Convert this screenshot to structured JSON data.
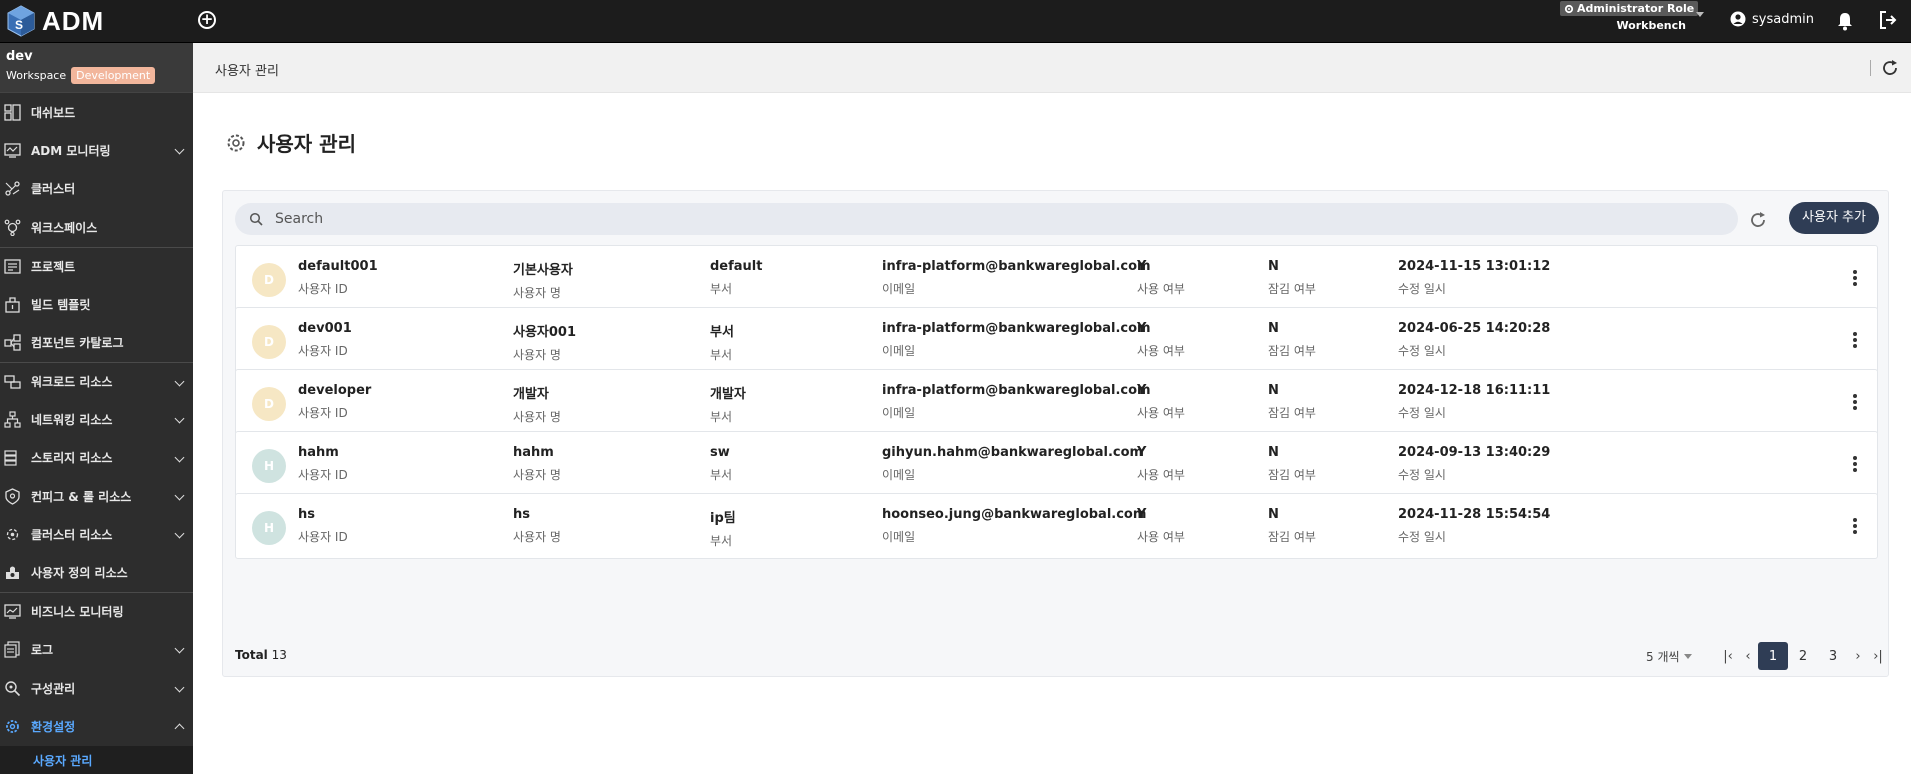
{
  "app": {
    "title": "ADM"
  },
  "topbar": {
    "role": "Administrator Role",
    "role_sub": "Workbench",
    "username": "sysadmin"
  },
  "workspace": {
    "name": "dev",
    "label": "Workspace",
    "badge": "Development"
  },
  "sidebar": {
    "items": [
      {
        "label": "대쉬보드",
        "icon": "dashboard-icon"
      },
      {
        "label": "ADM 모니터링",
        "icon": "monitor-icon"
      },
      {
        "label": "클러스터",
        "icon": "cluster-icon"
      },
      {
        "label": "워크스페이스",
        "icon": "workspace-icon"
      },
      {
        "label": "프로젝트",
        "icon": "project-icon"
      },
      {
        "label": "빌드 템플릿",
        "icon": "build-template-icon"
      },
      {
        "label": "컴포넌트 카탈로그",
        "icon": "component-catalog-icon"
      },
      {
        "label": "워크로드 리소스",
        "icon": "workload-icon"
      },
      {
        "label": "네트워킹 리소스",
        "icon": "network-icon"
      },
      {
        "label": "스토리지 리소스",
        "icon": "storage-icon"
      },
      {
        "label": "컨피그 & 롤 리소스",
        "icon": "config-icon"
      },
      {
        "label": "클러스터 리소스",
        "icon": "cluster-resource-icon"
      },
      {
        "label": "사용자 정의 리소스",
        "icon": "custom-resource-icon"
      },
      {
        "label": "비즈니스 모니터링",
        "icon": "business-monitor-icon"
      },
      {
        "label": "로그",
        "icon": "log-icon"
      },
      {
        "label": "구성관리",
        "icon": "config-manage-icon"
      },
      {
        "label": "환경설정",
        "icon": "settings-icon"
      }
    ],
    "sub_active": "사용자 관리"
  },
  "breadcrumb": "사용자 관리",
  "page": {
    "title": "사용자 관리"
  },
  "search": {
    "placeholder": "Search"
  },
  "add_user_label": "사용자 추가",
  "labels": {
    "id": "사용자 ID",
    "name": "사용자 명",
    "dept": "부서",
    "email": "이메일",
    "use": "사용 여부",
    "lock": "잠김 여부",
    "modified": "수정 일시"
  },
  "users": [
    {
      "initial": "D",
      "id": "default001",
      "name": "기본사용자",
      "dept": "default",
      "email": "infra-platform@bankwareglobal.com",
      "use": "Y",
      "lock": "N",
      "modified": "2024-11-15 13:01:12"
    },
    {
      "initial": "D",
      "id": "dev001",
      "name": "사용자001",
      "dept": "부서",
      "email": "infra-platform@bankwareglobal.com",
      "use": "Y",
      "lock": "N",
      "modified": "2024-06-25 14:20:28"
    },
    {
      "initial": "D",
      "id": "developer",
      "name": "개발자",
      "dept": "개발자",
      "email": "infra-platform@bankwareglobal.com",
      "use": "Y",
      "lock": "N",
      "modified": "2024-12-18 16:11:11"
    },
    {
      "initial": "H",
      "id": "hahm",
      "name": "hahm",
      "dept": "sw",
      "email": "gihyun.hahm@bankwareglobal.com",
      "use": "Y",
      "lock": "N",
      "modified": "2024-09-13 13:40:29"
    },
    {
      "initial": "H",
      "id": "hs",
      "name": "hs",
      "dept": "ip팀",
      "email": "hoonseo.jung@bankwareglobal.com",
      "use": "Y",
      "lock": "N",
      "modified": "2024-11-28 15:54:54"
    }
  ],
  "footer": {
    "total_label": "Total",
    "total": "13",
    "per_page": "5 개씩",
    "pages": [
      "1",
      "2",
      "3"
    ],
    "current_page": "1"
  },
  "colors": {
    "avatar_d": "#f6e7c4",
    "avatar_h": "#cfe3e0",
    "accent": "#2f3d55",
    "active_nav": "#5aa9ff"
  }
}
